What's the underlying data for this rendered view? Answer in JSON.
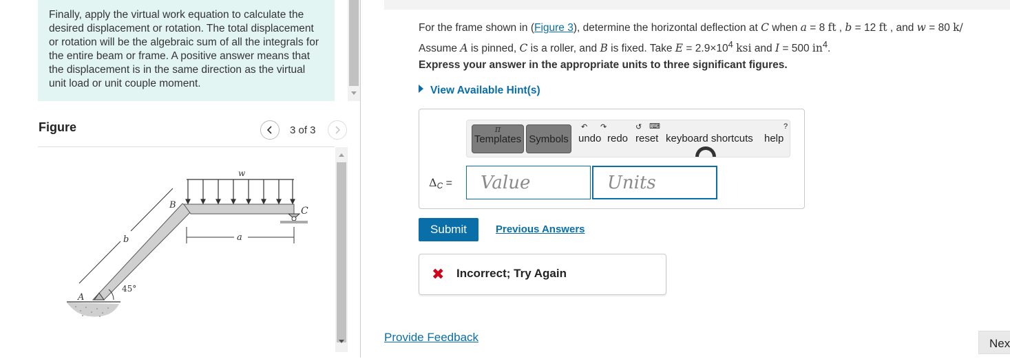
{
  "hint_panel": {
    "text": "Finally, apply the virtual work equation to calculate the desired displacement or rotation. The total displacement or rotation will be the algebraic sum of all the integrals for the entire beam or frame. A positive answer means that the displacement is in the same direction as the virtual unit load or unit couple moment."
  },
  "figure_panel": {
    "title": "Figure",
    "prev_icon": "chevron-left",
    "next_icon": "chevron-right",
    "page_indicator": "3 of 3",
    "labels": {
      "w": "w",
      "B": "B",
      "C": "C",
      "b": "b",
      "a": "a",
      "A": "A",
      "angle": "45°"
    }
  },
  "problem": {
    "line1_prefix": "For the frame shown in (",
    "figure_link": "Figure 3",
    "line1_mid": "), determine the horizontal deflection at ",
    "point_C": "C",
    "line1_when": " when ",
    "a_var": "a",
    "a_val": " = 8 ",
    "a_unit": "ft",
    "b_var": "b",
    "b_val": " = 12 ",
    "b_unit": "ft",
    "and_text": " , and ",
    "w_var": "w",
    "w_val": " = 80 ",
    "w_unit": "k/",
    "line2_assume": "Assume ",
    "point_A": "A",
    "line2_pinned": " is pinned, ",
    "point_C2": "C",
    "line2_roller": " is a roller, and ",
    "point_B": "B",
    "line2_fixed": " is fixed. Take ",
    "E_var": "E",
    "E_val": " = 2.9×10",
    "E_exp": "4",
    "E_unit": "ksi",
    "and2": " and ",
    "I_var": "I",
    "I_val": " = 500 ",
    "I_unit": "in",
    "I_exp": "4",
    "period": "."
  },
  "instruction": "Express your answer in the appropriate units to three significant figures.",
  "hints_toggle": "View Available Hint(s)",
  "toolbar": {
    "templates_label": "Templates",
    "symbols_label": "Symbols",
    "undo_label": "undo",
    "redo_label": "redo",
    "reset_label": "reset",
    "shortcuts_label": "keyboard shortcuts",
    "help_label": "help",
    "templates_glyph": "π"
  },
  "answer": {
    "label_delta": "Δ",
    "label_sub": "C",
    "label_eq": " =",
    "value_placeholder": "Value",
    "units_placeholder": "Units"
  },
  "submit_label": "Submit",
  "previous_answers_label": "Previous Answers",
  "feedback": {
    "icon": "x-icon",
    "text": "Incorrect; Try Again",
    "color": "#d0021b"
  },
  "provide_feedback_label": "Provide Feedback",
  "next_label": "Nex",
  "colors": {
    "accent": "#0a6ea8",
    "hint_bg": "#e3f5f3"
  }
}
